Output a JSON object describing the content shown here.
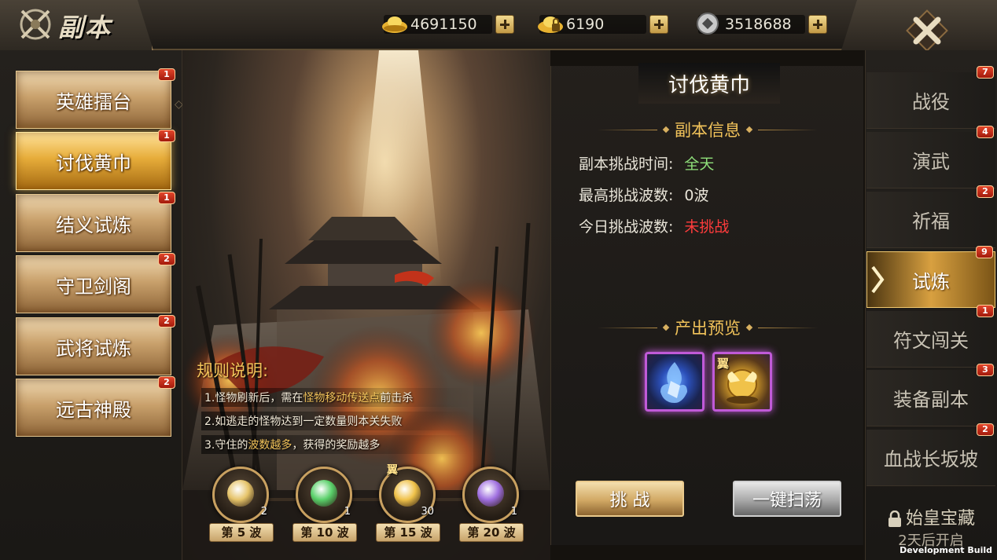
{
  "header": {
    "title": "副本",
    "currencies": [
      {
        "icon": "gold-ingot-icon",
        "value": "4691150"
      },
      {
        "icon": "locked-gold-ingot-icon",
        "value": "6190"
      },
      {
        "icon": "silver-coin-icon",
        "value": "3518688"
      }
    ]
  },
  "left_menu": [
    {
      "label": "英雄擂台",
      "badge": "1",
      "active": false
    },
    {
      "label": "讨伐黄巾",
      "badge": "1",
      "active": true
    },
    {
      "label": "结义试炼",
      "badge": "1",
      "active": false
    },
    {
      "label": "守卫剑阁",
      "badge": "2",
      "active": false
    },
    {
      "label": "武将试炼",
      "badge": "2",
      "active": false
    },
    {
      "label": "远古神殿",
      "badge": "2",
      "active": false
    }
  ],
  "rules": {
    "title": "规则说明:",
    "lines": [
      {
        "pre": "1.怪物刷新后，需在",
        "hl": "怪物移动传送点",
        "post": "前击杀"
      },
      {
        "pre": "2.如逃走的怪物达到一定数量则本关失败",
        "hl": "",
        "post": ""
      },
      {
        "pre": "3.守住的",
        "hl": "波数越多",
        "post": "，获得的奖励越多"
      }
    ]
  },
  "waves": [
    {
      "label": "第 5 波",
      "count": "2",
      "icon": "scroll-icon",
      "tag": ""
    },
    {
      "label": "第 10 波",
      "count": "1",
      "icon": "jade-chest-icon",
      "tag": ""
    },
    {
      "label": "第 15 波",
      "count": "30",
      "icon": "gold-wing-orb-icon",
      "tag": "翼"
    },
    {
      "label": "第 20 波",
      "count": "1",
      "icon": "purple-orb-icon",
      "tag": ""
    }
  ],
  "info": {
    "title": "讨伐黄巾",
    "section_info": "副本信息",
    "rows": [
      {
        "label": "副本挑战时间:",
        "value": "全天",
        "color": "#8fe07a"
      },
      {
        "label": "最高挑战波数:",
        "value": "0波",
        "color": "#e8e4d8"
      },
      {
        "label": "今日挑战波数:",
        "value": "未挑战",
        "color": "#ff3c3c"
      }
    ],
    "section_reward": "产出预览",
    "rewards": [
      {
        "icon": "blue-flame-crystal-icon",
        "tag": ""
      },
      {
        "icon": "gold-wing-orb-icon",
        "tag": "翼"
      }
    ],
    "challenge_label": "挑 战",
    "sweep_label": "一键扫荡"
  },
  "right_menu": [
    {
      "label": "战役",
      "badge": "7",
      "active": false
    },
    {
      "label": "演武",
      "badge": "4",
      "active": false
    },
    {
      "label": "祈福",
      "badge": "2",
      "active": false
    },
    {
      "label": "试炼",
      "badge": "9",
      "active": true
    },
    {
      "label": "符文闯关",
      "badge": "1",
      "active": false
    },
    {
      "label": "装备副本",
      "badge": "3",
      "active": false
    },
    {
      "label": "血战长坂坡",
      "badge": "2",
      "active": false
    }
  ],
  "locked_item": {
    "name": "始皇宝藏",
    "sub": "2天后开启"
  },
  "footer": {
    "build": "Development Build"
  },
  "colors": {
    "accent_gold": "#f2c35a",
    "badge_red": "#d0301c",
    "status_green": "#8fe07a",
    "status_red": "#ff3c3c"
  }
}
